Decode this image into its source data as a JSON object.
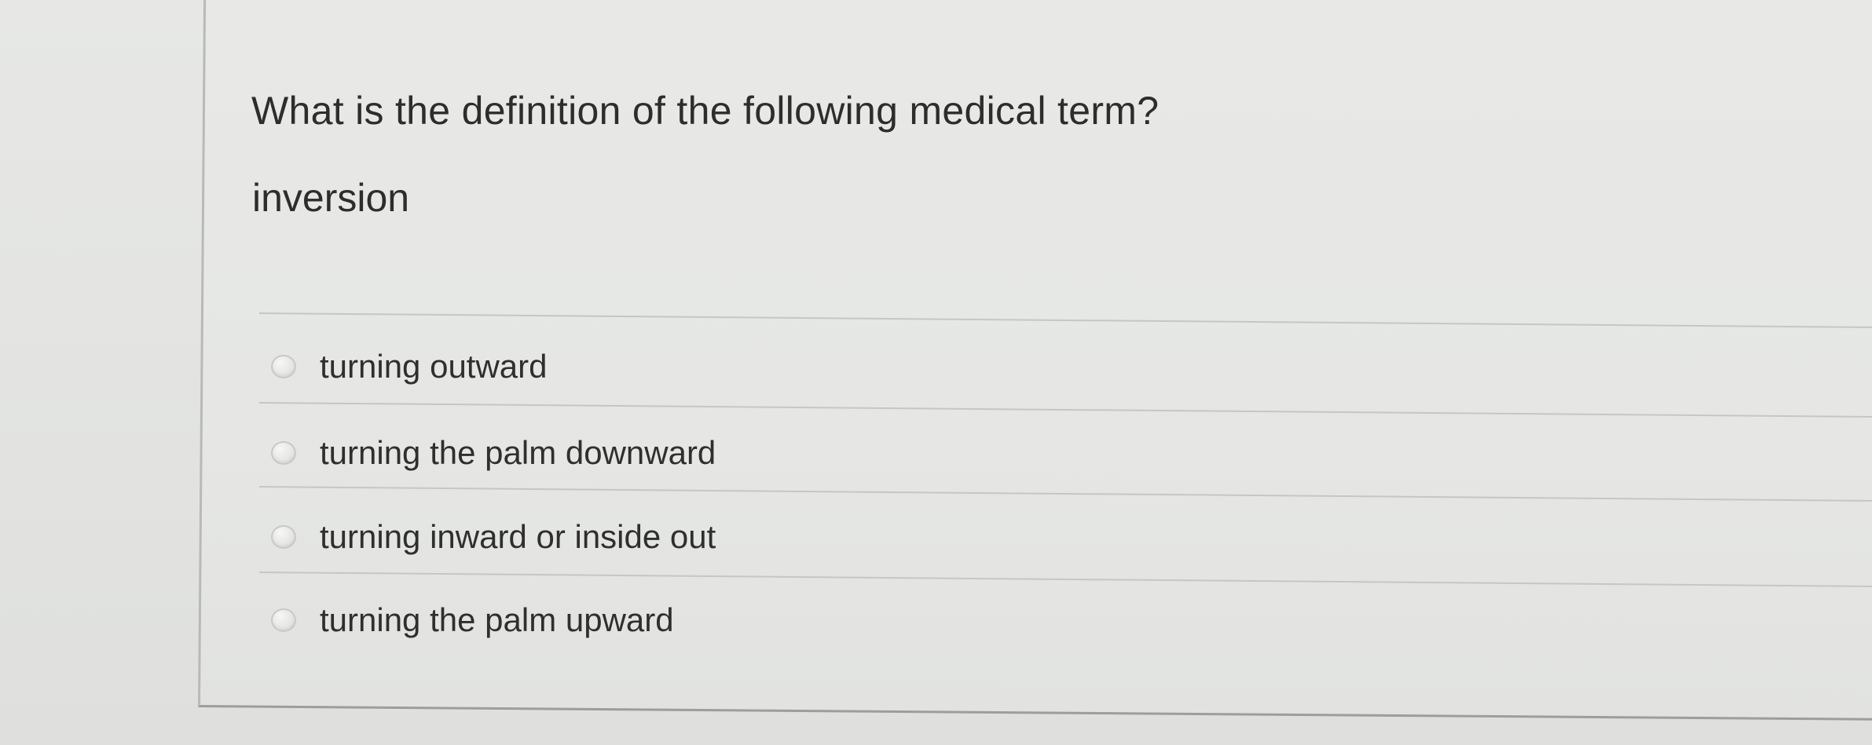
{
  "question": {
    "prompt": "What is the definition of the following medical term?",
    "term": "inversion"
  },
  "options": [
    {
      "label": "turning outward",
      "selected": false
    },
    {
      "label": "turning the palm downward",
      "selected": false
    },
    {
      "label": "turning inward or inside out",
      "selected": false
    },
    {
      "label": "turning the palm upward",
      "selected": false
    }
  ]
}
